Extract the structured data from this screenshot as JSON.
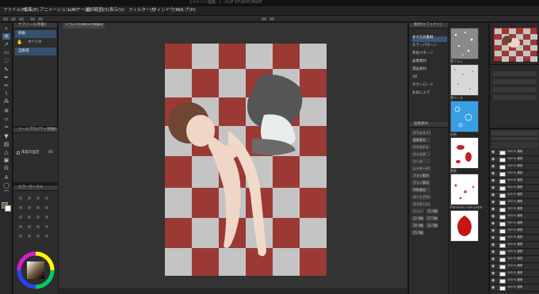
{
  "app": {
    "title": "[ペイント画像...] - CLIP STUDIO PAINT"
  },
  "menu": [
    "ファイル(F)",
    "編集(E)",
    "アニメーション(A)",
    "レイヤー(L)",
    "選択範囲(S)",
    "表示(V)",
    "フィルター(I)",
    "ウィンドウ(W)",
    "ヘルプ(H)"
  ],
  "sub_tool": {
    "header": "サブツール[移動]",
    "items": [
      "移動",
      "すべての",
      "自動選"
    ]
  },
  "tool_property": {
    "header": "ツールプロパティ[移動]",
    "label": "角度の固定",
    "value": "45"
  },
  "color": {
    "header": "カラーサークル"
  },
  "canvas": {
    "tab_label": "イラスト(500×700px)"
  },
  "materials": {
    "header": "素材[エフェクト]",
    "categories": [
      "すべての素材",
      "カラーパターン",
      "単色パターン",
      "画像素材",
      "漫画素材",
      "3D",
      "ダウンロード",
      "お気に入り"
    ],
    "selected_category": "すべての素材",
    "presets_header": "画像素材",
    "presets": [
      "デフォルトカラ",
      "画像素材",
      "テクスチャ",
      "フィルタ",
      "ツール",
      "レイヤーテンプレート",
      "ブラシ素材",
      "プラン素材",
      "特殊素材",
      "オートアクション",
      "グラデーション",
      "トーン"
    ],
    "presets_small": [
      "15.0線",
      "22.0線",
      "27.5線",
      "30.0線",
      "32.5線",
      "35.0線"
    ],
    "thumbnails": [
      {
        "label": "雪ブラシ",
        "style": "snow"
      },
      {
        "label": "雪ベース",
        "style": "snow2"
      },
      {
        "label": "水泡",
        "style": "water"
      },
      {
        "label": "薔薇",
        "style": "petal"
      },
      {
        "label": "Romantic rose petal",
        "style": "petal2"
      },
      {
        "label": "",
        "style": "red"
      }
    ]
  },
  "layers": {
    "rows": [
      "100 % 通常",
      "100 % 通常",
      "100 % 通常",
      "100 % 通常",
      "100 % 通常",
      "100 % 通常",
      "100 % 通常",
      "100 % 通常",
      "100 % 通常",
      "100 % 通常",
      "100 % 通常",
      "100 % 通常",
      "100 % 通常",
      "100 % 通常",
      "100 % 通常",
      "100 % 通常",
      "100 % 通常",
      "100 % 通常",
      "100 % 通常",
      "100 % 通常"
    ]
  },
  "colors": {
    "accent": "#3e5f86",
    "checker_red": "#9b3a34",
    "checker_gray": "#c4c4c4",
    "main_color": "#7a6048",
    "sub_color": "#ffffff"
  }
}
